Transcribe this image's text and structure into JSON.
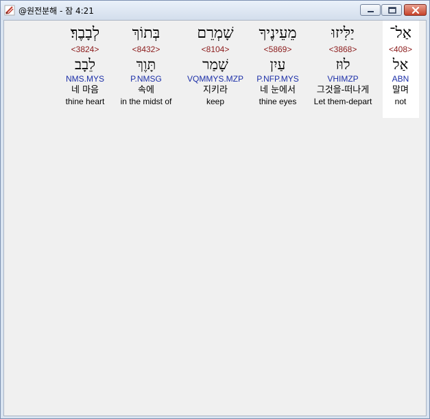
{
  "window": {
    "title": "@원전분해 - 잠 4:21"
  },
  "words": [
    {
      "hebrew": "אַל־",
      "strong": "<408>",
      "lemma": "אַל",
      "morph": "ABN",
      "korean": "말며",
      "english": "not"
    },
    {
      "hebrew": "יַלִּיזוּ",
      "strong": "<3868>",
      "lemma": "לוּז",
      "morph": "VHIMZP",
      "korean": "그것을-떠나게",
      "english": "Let them-depart"
    },
    {
      "hebrew": "מֵעֵינֶיךָ",
      "strong": "<5869>",
      "lemma": "עַיִן",
      "morph": "P.NFP.MYS",
      "korean": "네 눈에서",
      "english": "thine eyes"
    },
    {
      "hebrew": "שָׁמְרֵם",
      "strong": "<8104>",
      "lemma": "שָׁמַר",
      "morph": "VQMMYS.MZP",
      "korean": "지키라",
      "english": "keep"
    },
    {
      "hebrew": "בְּתוֹךְ",
      "strong": "<8432>",
      "lemma": "תָּוֶךְ",
      "morph": "P.NMSG",
      "korean": "속에",
      "english": "in the midst of"
    },
    {
      "hebrew": "לְבָבֶךָ׃",
      "strong": "<3824>",
      "lemma": "לֵבָב",
      "morph": "NMS.MYS",
      "korean": "네 마음",
      "english": "thine heart"
    }
  ]
}
